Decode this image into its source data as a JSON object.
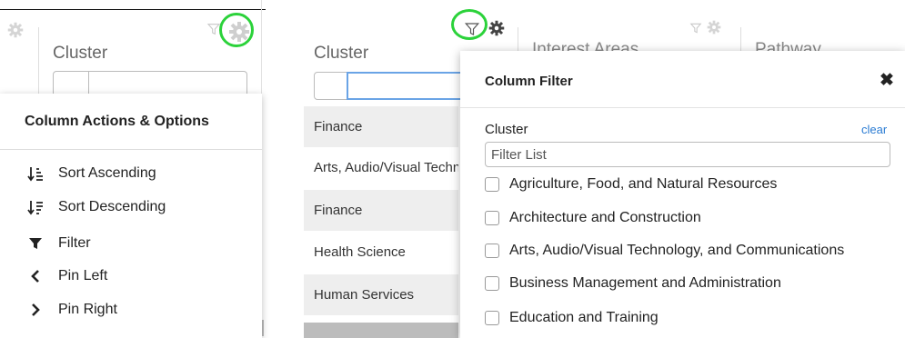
{
  "left": {
    "column_header": "Cluster",
    "menu": {
      "title": "Column Actions & Options",
      "items": [
        {
          "label": "Sort Ascending",
          "icon": "sort-ascending-icon"
        },
        {
          "label": "Sort Descending",
          "icon": "sort-descending-icon"
        },
        {
          "label": "Filter",
          "icon": "filter-icon"
        },
        {
          "label": "Pin Left",
          "icon": "chevron-left-icon"
        },
        {
          "label": "Pin Right",
          "icon": "chevron-right-icon"
        }
      ]
    }
  },
  "right": {
    "column_headers": {
      "cluster": "Cluster",
      "interest_areas": "Interest Areas",
      "pathway": "Pathway"
    },
    "rows": [
      "Finance",
      "Arts, Audio/Visual Technology, and Communications",
      "Finance",
      "Health Science",
      "Human Services"
    ],
    "filter_popup": {
      "title": "Column Filter",
      "close_label": "✖",
      "field_label": "Cluster",
      "clear_label": "clear",
      "list_placeholder": "Filter List",
      "options": [
        "Agriculture, Food, and Natural Resources",
        "Architecture and Construction",
        "Arts, Audio/Visual Technology, and Communications",
        "Business Management and Administration",
        "Education and Training"
      ]
    }
  },
  "colors": {
    "highlight_ring": "#2bd23a",
    "link": "#2a7bd3",
    "active_input_border": "#6aa4e6",
    "row_shade": "#eeeeee"
  }
}
